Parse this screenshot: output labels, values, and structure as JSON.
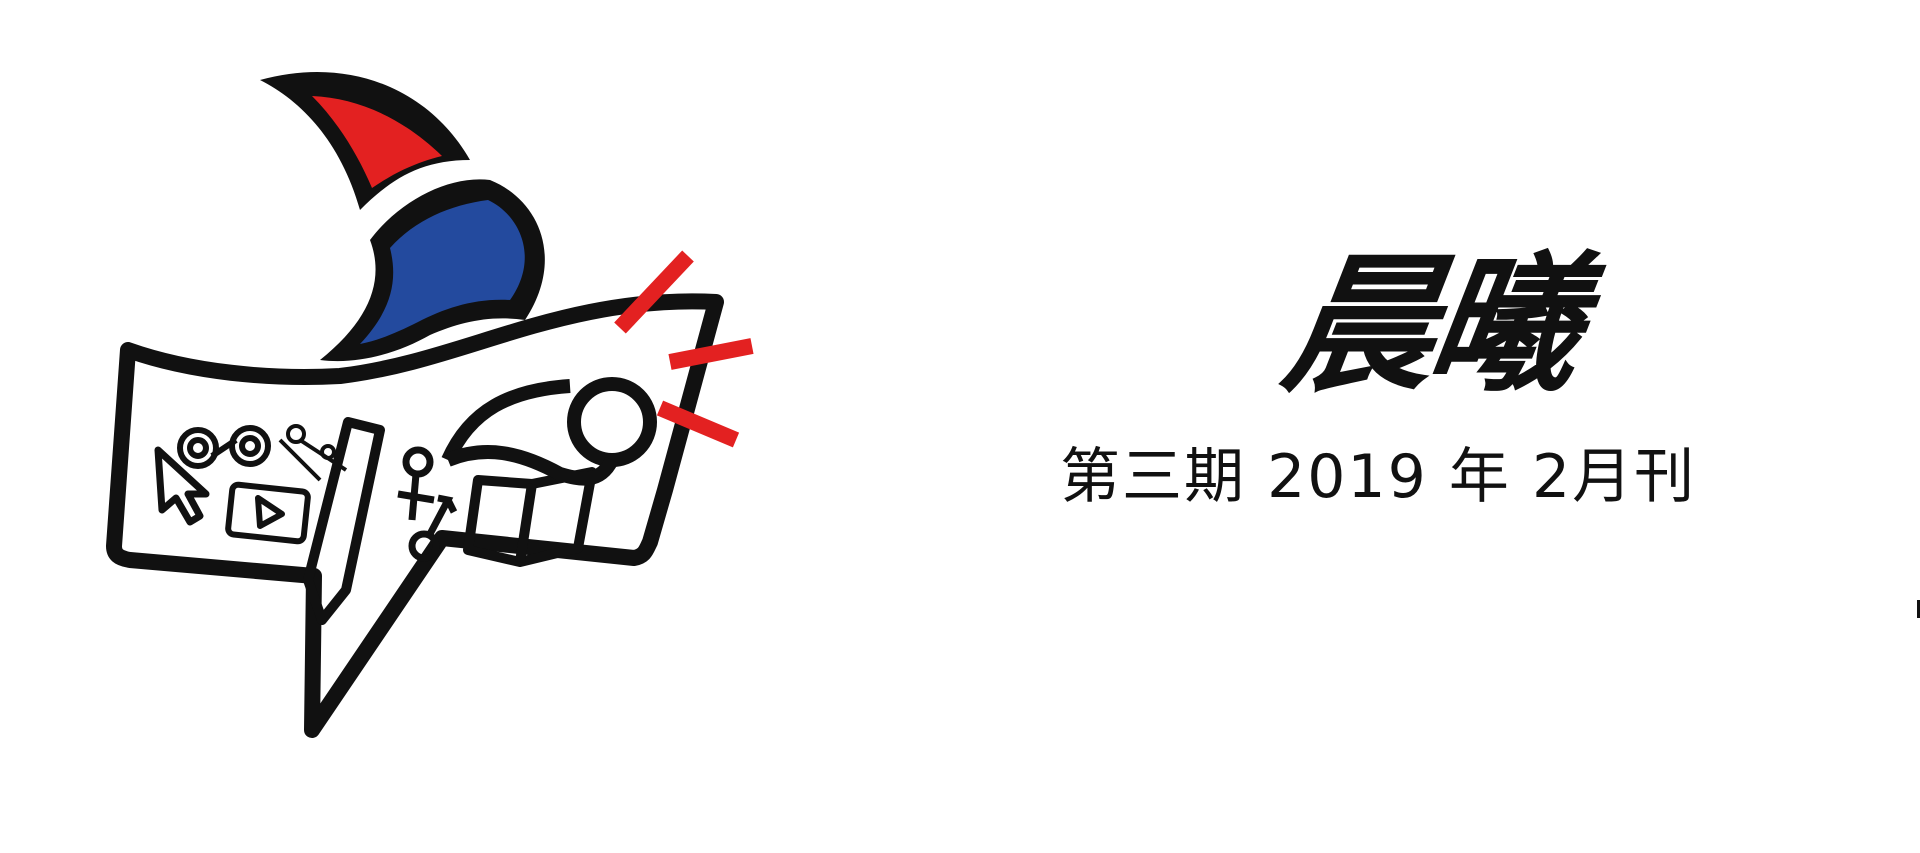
{
  "colors": {
    "brand_red": "#e32121",
    "brand_blue": "#234a9e",
    "ink": "#111111",
    "background": "#ffffff"
  },
  "logo": {
    "name": "speech-bubble-sail-logo",
    "icons": [
      "cursor-icon",
      "infinity-icon",
      "play-icon",
      "wrench-key-icon",
      "gender-symbols-icon",
      "open-book-icon",
      "pencil-icon",
      "lens-icon"
    ]
  },
  "masthead": {
    "title": "晨曦",
    "issue_label": "第三期",
    "year": "2019",
    "year_unit": "年",
    "month": "2",
    "month_unit": "月刊"
  }
}
